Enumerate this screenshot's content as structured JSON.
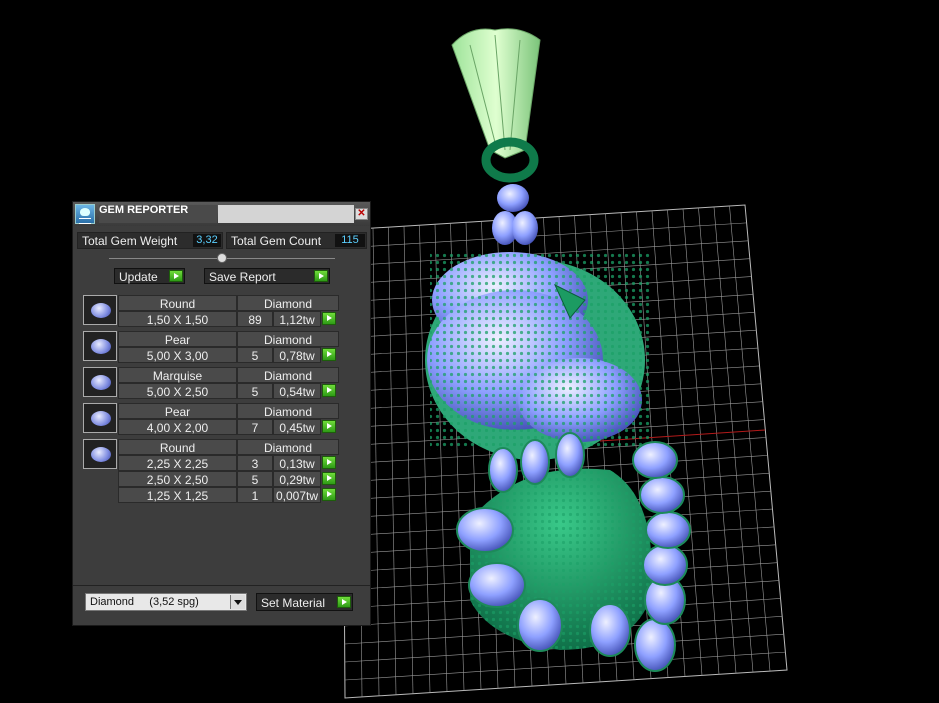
{
  "panel": {
    "title": "GEM REPORTER",
    "close_icon": "close-icon",
    "total_weight_label": "Total Gem Weight",
    "total_weight_value": "3,32",
    "total_count_label": "Total Gem Count",
    "total_count_value": "115",
    "update_label": "Update",
    "save_report_label": "Save Report",
    "gems": [
      {
        "shape": "Round",
        "material": "Diamond",
        "rows": [
          {
            "size": "1,50 X 1,50",
            "count": "89",
            "tw": "1,12tw"
          }
        ]
      },
      {
        "shape": "Pear",
        "material": "Diamond",
        "rows": [
          {
            "size": "5,00 X 3,00",
            "count": "5",
            "tw": "0,78tw"
          }
        ]
      },
      {
        "shape": "Marquise",
        "material": "Diamond",
        "rows": [
          {
            "size": "5,00 X 2,50",
            "count": "5",
            "tw": "0,54tw"
          }
        ]
      },
      {
        "shape": "Pear",
        "material": "Diamond",
        "rows": [
          {
            "size": "4,00 X 2,00",
            "count": "7",
            "tw": "0,45tw"
          }
        ]
      },
      {
        "shape": "Round",
        "material": "Diamond",
        "rows": [
          {
            "size": "2,25 X 2,25",
            "count": "3",
            "tw": "0,13tw"
          },
          {
            "size": "2,50 X 2,50",
            "count": "5",
            "tw": "0,29tw"
          },
          {
            "size": "1,25 X 1,25",
            "count": "1",
            "tw": "0,007tw"
          }
        ]
      }
    ],
    "material_select_value": "Diamond     (3,52 spg)",
    "set_material_label": "Set Material"
  },
  "colors": {
    "panel_bg": "#3d3d3d",
    "accent_green": "#4cc423",
    "value_cyan": "#5bd0ff",
    "gem_blue": "#7c8ae0",
    "metal_green": "#1d8a5a"
  }
}
